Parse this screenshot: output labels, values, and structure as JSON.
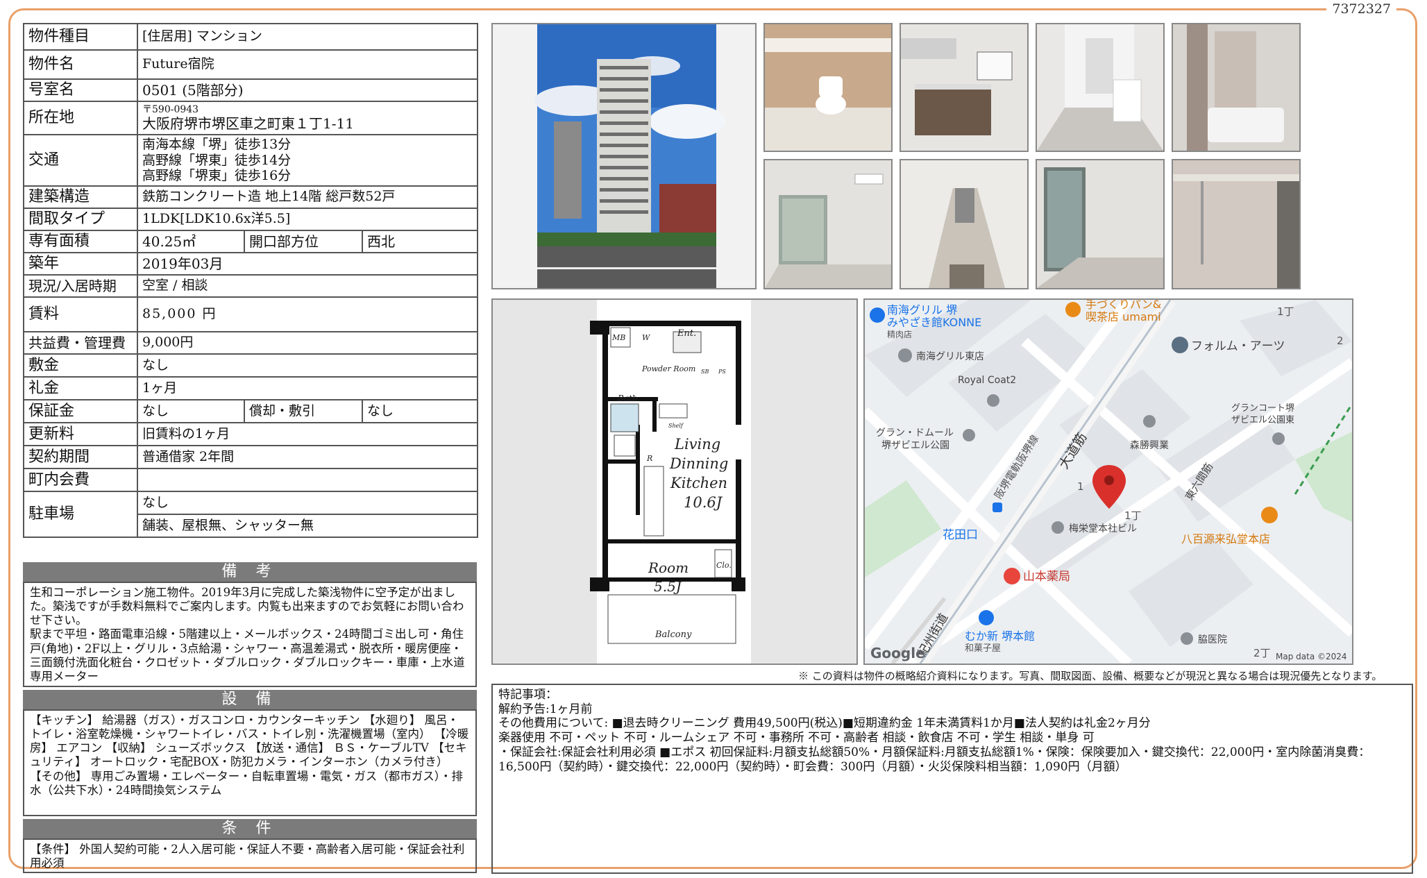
{
  "doc_id": "7372327",
  "property": {
    "rows": {
      "type": {
        "label": "物件種目",
        "value": "[住居用]  マンション"
      },
      "name": {
        "label": "物件名",
        "value": "Future宿院"
      },
      "room": {
        "label": "号室名",
        "value": "0501 (5階部分)"
      },
      "address": {
        "label": "所在地",
        "zip": "〒590-0943",
        "value": "大阪府堺市堺区車之町東１丁1-11"
      },
      "access": {
        "label": "交通",
        "lines": [
          "南海本線「堺」徒歩13分",
          "高野線「堺東」徒歩14分",
          "高野線「堺東」徒歩16分"
        ]
      },
      "structure": {
        "label": "建築構造",
        "value": "鉄筋コンクリート造 地上14階 総戸数52戸"
      },
      "layout": {
        "label": "間取タイプ",
        "value": "1LDK[LDK10.6x洋5.5]"
      },
      "area": {
        "label": "専有面積",
        "value": "40.25㎡",
        "sub_label": "開口部方位",
        "sub_value": "西北"
      },
      "built": {
        "label": "築年",
        "value": "2019年03月"
      },
      "status": {
        "label": "現況/入居時期",
        "value": "空室 / 相談"
      },
      "rent": {
        "label": "賃料",
        "value": "85,000 円"
      },
      "fee": {
        "label": "共益費・管理費",
        "value": "9,000円"
      },
      "deposit": {
        "label": "敷金",
        "value": "なし"
      },
      "key_money": {
        "label": "礼金",
        "value": "1ヶ月"
      },
      "guarantee": {
        "label": "保証金",
        "value": "なし",
        "sub_label": "償却・敷引",
        "sub_value": "なし"
      },
      "renewal": {
        "label": "更新料",
        "value": "旧賃料の1ヶ月"
      },
      "contract": {
        "label": "契約期間",
        "value": "普通借家 2年間"
      },
      "town_fee": {
        "label": "町内会費",
        "value": ""
      },
      "parking": {
        "label": "駐車場",
        "value": "なし",
        "value2": "舗装、屋根無、シャッター無"
      }
    }
  },
  "remarks": {
    "title": "備 考",
    "text": "生和コーポレーション施工物件。2019年3月に完成した築浅物件に空予定が出ました。築浅ですが手数料無料でご案内します。内覧も出来ますのでお気軽にお問い合わせ下さい。",
    "text2": "駅まで平坦・路面電車沿線・5階建以上・メールボックス・24時間ゴミ出し可・角住戸(角地)・2F以上・グリル・3点給湯・シャワー・高温差湯式・脱衣所・暖房便座・三面鏡付洗面化粧台・クロゼット・ダブルロック・ダブルロックキー・車庫・上水道 専用メーター"
  },
  "equipment": {
    "title": "設 備",
    "text": "【キッチン】 給湯器（ガス）・ガスコンロ・カウンターキッチン 【水廻り】 風呂・トイレ・浴室乾燥機・シャワートイレ・バス・トイレ別・洗濯機置場（室内） 【冷暖房】 エアコン 【収納】 シューズボックス 【放送・通信】 ＢＳ・ケーブルTV 【セキュリティ】 オートロック・宅配BOX・防犯カメラ・インターホン（カメラ付き） 【その他】 専用ごみ置場・エレベーター・自転車置場・電気・ガス（都市ガス）・排水（公共下水）・24時間換気システム"
  },
  "conditions": {
    "title": "条 件",
    "text": "【条件】 外国人契約可能・2人入居可能・保証人不要・高齢者入居可能・保証会社利用必須"
  },
  "floorplan": {
    "mb": "MB",
    "w": "W",
    "ent": "Ent.",
    "powder": "Powder Room",
    "sb": "SB",
    "ps": "PS",
    "bath": "Bath",
    "shelf": "Shelf",
    "r": "R",
    "ldk": [
      "Living",
      "Dinning",
      "Kitchen",
      "10.6J"
    ],
    "room": [
      "Room",
      "5.5J"
    ],
    "clo": "Clo.",
    "balcony": "Balcony"
  },
  "map": {
    "labels": {
      "nankai_grill": "南海グリル 堺",
      "miyazaki": "みやざき館KONNE",
      "seiniku": "精肉店",
      "bread": "手づくりパン&",
      "cafe": "喫茶店 umami",
      "chome1_top": "1丁",
      "two": "2",
      "form_arts": "フォルム・アーツ",
      "nankai_east": "南海グリル東店",
      "royal": "Royal Coat2",
      "grand_dome": "グラン・ドムール",
      "grand_dome2": "堺ザビエル公園",
      "grand_court": "グランコート堺",
      "grand_court2": "ザビエル公園東",
      "hankai": "阪堺電軌阪堺線",
      "odomi": "大道筋",
      "morikatsu": "森勝興業",
      "one": "1",
      "higashi_roku": "東六間筋",
      "chome1": "1丁",
      "baieido": "梅栄堂本社ビル",
      "yaoya": "八百源来弘堂本店",
      "hanadaguchi": "花田口",
      "yamamoto": "山本薬局",
      "kishu": "紀州街道",
      "mukashin": "むか新 堺本館",
      "wagashi": "和菓子屋",
      "clinic": "脇医院",
      "chome2": "2丁",
      "google": "Google",
      "mapdata": "Map data ©2024"
    }
  },
  "disclaimer": "※ この資料は物件の概略紹介資料になります。写真、間取図面、設備、概要などが現況と異なる場合は現況優先となります。",
  "special": {
    "title": "特記事項：",
    "line1": "解約予告:1ヶ月前",
    "line2": "その他費用について: ■退去時クリーニング 費用49,500円(税込)■短期違約金 1年未満賃料1か月■法人契約は礼金2ヶ月分",
    "line3": "楽器使用 不可・ペット 不可・ルームシェア 不可・事務所 不可・高齢者 相談・飲食店 不可・学生 相談・単身 可",
    "line4": "・保証会社:保証会社利用必須 ■エポス 初回保証料:月額支払総額50%・月額保証料:月額支払総額1%・保険：保険要加入・鍵交換代：22,000円・室内除菌消臭費：16,500円（契約時）・鍵交換代：22,000円（契約時）・町会費：300円（月額）・火災保険料相当額：1,090円（月額）"
  },
  "colors": {
    "frame": "#e8a06a",
    "section_bar": "#7b7b7b",
    "map_pin": "#d9302c",
    "map_poi_orange": "#e98a17",
    "map_poi_blue": "#1a73e8"
  }
}
